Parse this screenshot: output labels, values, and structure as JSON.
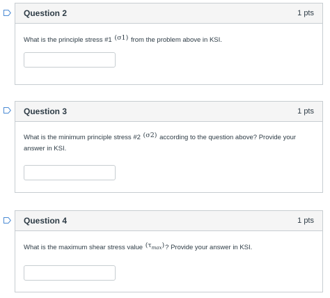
{
  "questions": [
    {
      "title": "Question 2",
      "points": "1 pts",
      "text_before": "What is the principle stress #1 ",
      "symbol": "(σ1)",
      "text_after": " from the problem above in KSI.",
      "answer_value": ""
    },
    {
      "title": "Question 3",
      "points": "1 pts",
      "text_before": "What is the minimum principle stress #2 ",
      "symbol": "(σ2)",
      "text_after": " according to the question above? Provide your answer in KSI.",
      "answer_value": ""
    },
    {
      "title": "Question 4",
      "points": "1 pts",
      "text_before": "What is the maximum shear stress value ",
      "symbol": "(τ",
      "symbol_sub": "max",
      "symbol_close": ")",
      "text_after": "? Provide your answer in KSI.",
      "answer_value": ""
    }
  ],
  "colors": {
    "header_bg": "#f5f5f5",
    "border": "#c7cdd1",
    "text": "#2d3b45",
    "flag_icon": "#4a8ad4"
  },
  "icons": {
    "flag": "bookmark-flag-icon"
  }
}
